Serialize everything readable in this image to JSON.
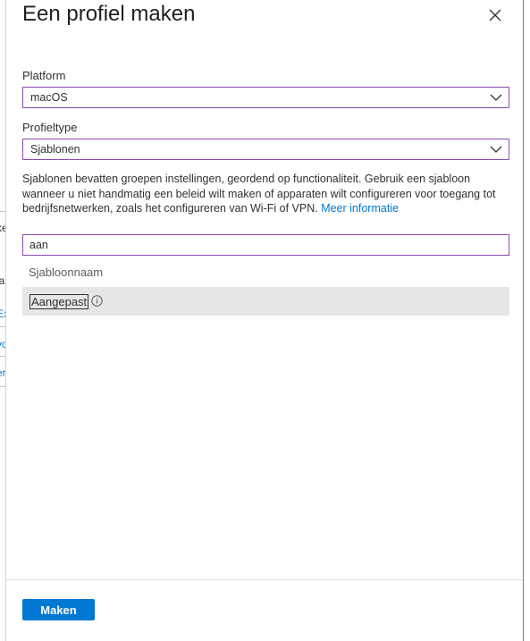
{
  "panel": {
    "title": "Een profiel maken"
  },
  "form": {
    "platform_label": "Platform",
    "platform_value": "macOS",
    "profiletype_label": "Profieltype",
    "profiletype_value": "Sjablonen"
  },
  "description": {
    "text": "Sjablonen bevatten groepen instellingen, geordend op functionaliteit. Gebruik een sjabloon wanneer u niet handmatig een beleid wilt maken of apparaten wilt configureren voor toegang tot bedrijfsnetwerken, zoals het configureren van Wi-Fi of VPN.",
    "link": "Meer informatie"
  },
  "search": {
    "value": "aan"
  },
  "list": {
    "column_header": "Sjabloonnaam",
    "rows": [
      {
        "name": "Aangepast"
      }
    ]
  },
  "footer": {
    "create_label": "Maken"
  },
  "backdrop": {
    "fragments": [
      "r",
      "ke",
      "la",
      "Ex",
      "vo",
      "er"
    ]
  },
  "colors": {
    "accent": "#0078d4",
    "focus_border": "#8a4bb3",
    "selected_row": "#e8e6e4"
  },
  "icons": {
    "close": "close-icon",
    "chevron": "chevron-down-icon",
    "info": "info-icon"
  }
}
